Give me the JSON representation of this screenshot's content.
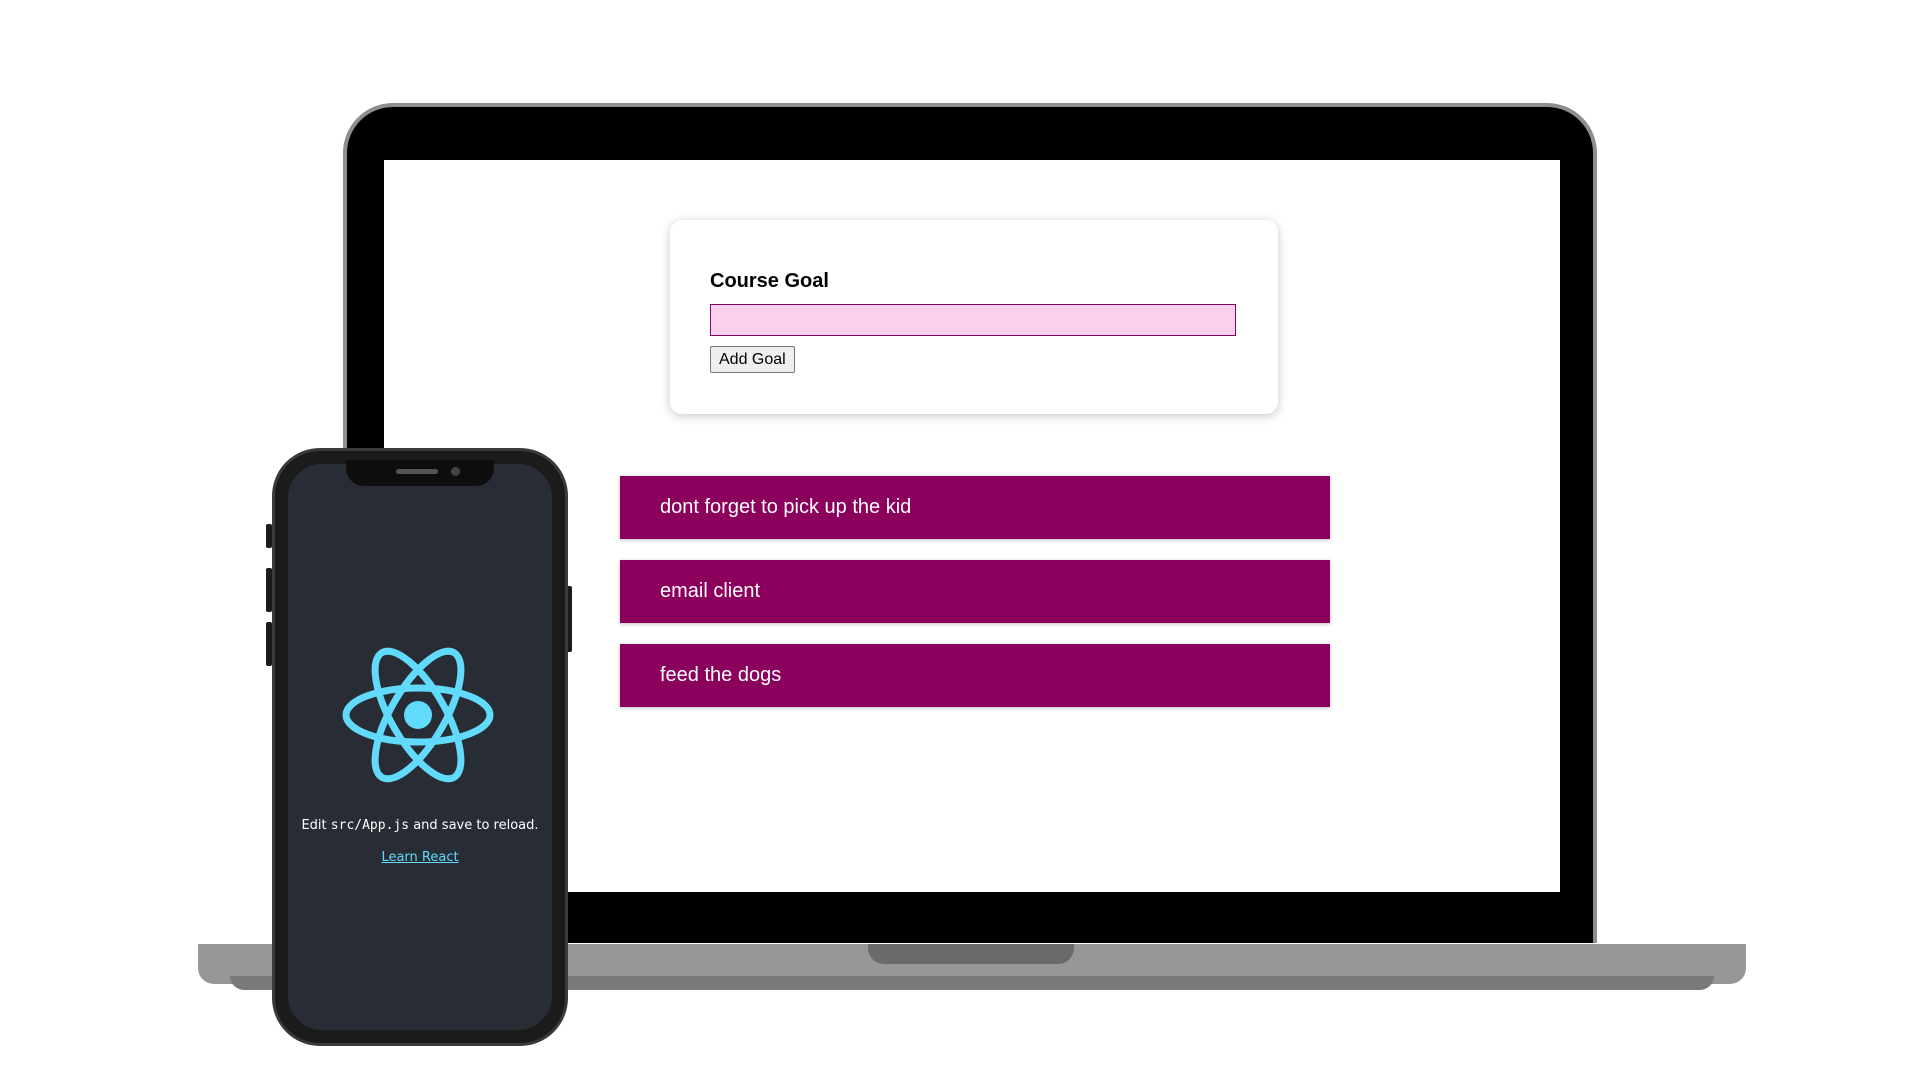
{
  "goal_form": {
    "label": "Course Goal",
    "input_value": "",
    "button_label": "Add Goal"
  },
  "goals": [
    {
      "text": "dont forget to pick up the kid"
    },
    {
      "text": "email client"
    },
    {
      "text": "feed the dogs"
    }
  ],
  "phone_app": {
    "edit_prefix": "Edit",
    "edit_code": "src/App.js",
    "edit_suffix": "and save to reload.",
    "link_label": "Learn React",
    "logo_icon": "react-logo-icon"
  },
  "colors": {
    "goal_item_bg": "#8b005d",
    "input_bg": "#fbd0ec",
    "phone_screen_bg": "#282c34",
    "react_accent": "#61dafb"
  }
}
